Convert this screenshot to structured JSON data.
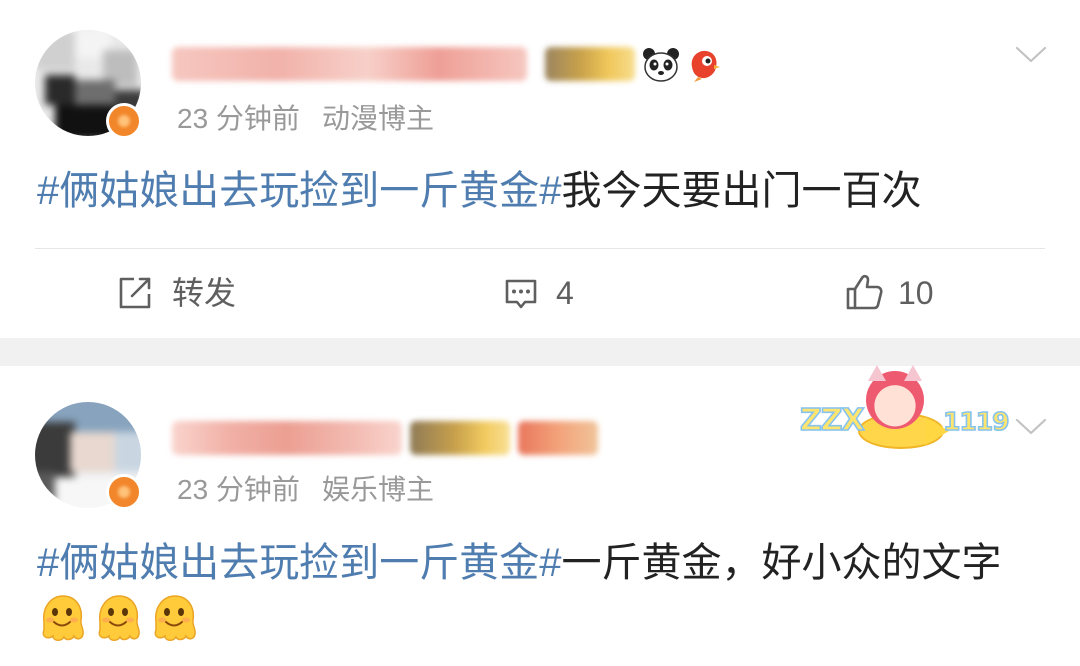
{
  "colors": {
    "topic": "#507daf",
    "text": "#222222",
    "meta": "#999999",
    "action": "#5f5f5f",
    "separator": "#f1f1f1",
    "verified": "#f2862a"
  },
  "posts": [
    {
      "time": "23 分钟前",
      "role": "动漫博主",
      "topic": "#俩姑娘出去玩捡到一斤黄金#",
      "text": "我今天要出门一百次",
      "badges": [
        "vip-crown-badge",
        "panda-icon",
        "red-bird-icon"
      ],
      "menu_icon": "chevron-down-icon",
      "actions": {
        "repost_label": "转发",
        "comment_count": "4",
        "like_count": "10",
        "icons": [
          "repost-icon",
          "comment-icon",
          "like-icon"
        ]
      }
    },
    {
      "time": "23 分钟前",
      "role": "娱乐博主",
      "topic": "#俩姑娘出去玩捡到一斤黄金#",
      "text": "一斤黄金，好小众的文字",
      "badges": [
        "vip-crown-badge",
        "fan-badge"
      ],
      "menu_icon": "chevron-down-icon",
      "decoration": {
        "left_text": "ZZX",
        "right_text": "1119"
      },
      "emojis": [
        "melting-face-icon",
        "melting-face-icon",
        "melting-face-icon"
      ]
    }
  ]
}
